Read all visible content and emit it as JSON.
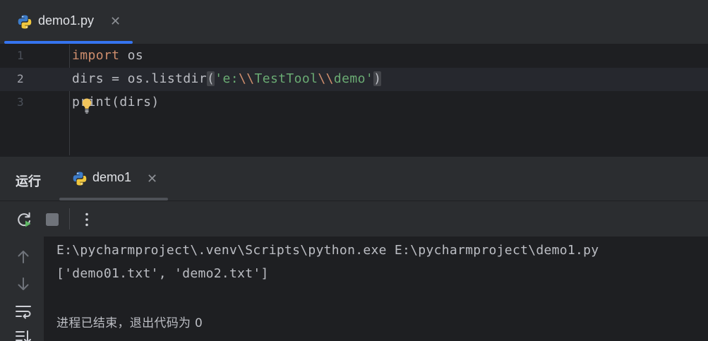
{
  "editor": {
    "tab": {
      "label": "demo1.py"
    },
    "lines": [
      {
        "number": "1",
        "kw": "import",
        "rest": " os"
      },
      {
        "number": "2",
        "var": "dirs = os.listdir",
        "open": "(",
        "str_open": "'e:",
        "esc1": "\\\\",
        "mid": "TestTool",
        "esc2": "\\\\",
        "str_close": "demo'",
        "close": ")"
      },
      {
        "number": "3",
        "text": "print(dirs)"
      }
    ]
  },
  "run": {
    "title": "运行",
    "tab": {
      "label": "demo1"
    },
    "console": [
      "E:\\pycharmproject\\.venv\\Scripts\\python.exe E:\\pycharmproject\\demo1.py",
      "['demo01.txt', 'demo2.txt']",
      "",
      "进程已结束，退出代码为 0"
    ]
  },
  "icons": {
    "file": "python-icon",
    "close": "close-icon",
    "rerun": "rerun-icon",
    "stop": "stop-icon",
    "more": "more-vertical-icon",
    "up": "arrow-up-icon",
    "down": "arrow-down-icon",
    "wrap": "soft-wrap-icon",
    "scroll": "scroll-to-end-icon",
    "bulb": "lightbulb-icon"
  },
  "colors": {
    "accent": "#3574f0",
    "keyword": "#cf8e6d",
    "string": "#6aab73",
    "text": "#bcbec4",
    "background": "#1e1f22",
    "panel": "#2b2d30"
  }
}
